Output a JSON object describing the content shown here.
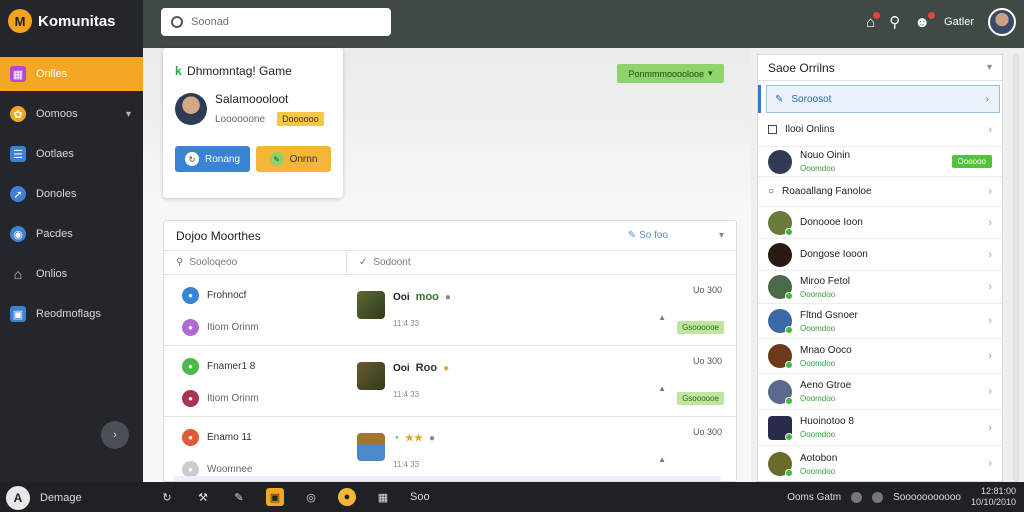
{
  "brand": {
    "name": "Komunitas",
    "logo_icon": "M"
  },
  "search": {
    "placeholder": "Soonad"
  },
  "topbar": {
    "user_label": "Gatler"
  },
  "sidebar": {
    "items": [
      {
        "label": "Onlles",
        "icon": "grid-icon",
        "color": "#b04ad8",
        "active": true
      },
      {
        "label": "Oomoos",
        "icon": "community-icon",
        "color": "#f5a623",
        "has_caret": true
      },
      {
        "label": "Ootlaes",
        "icon": "list-icon",
        "color": "#3a82d6"
      },
      {
        "label": "Donoles",
        "icon": "pin-icon",
        "color": "#3a82d6"
      },
      {
        "label": "Pacdes",
        "icon": "target-icon",
        "color": "#3a82d6"
      },
      {
        "label": "Onlios",
        "icon": "home-icon",
        "color": "#cfcfcf"
      },
      {
        "label": "Reodmoflags",
        "icon": "window-icon",
        "color": "#3a82d6"
      }
    ],
    "toggle_icon": "›"
  },
  "profile_card": {
    "title_prefix": "k",
    "title": "Dhmomntag! Game",
    "user_name": "Salamoooloot",
    "user_sub": "Loooooone",
    "user_badge": "Doooooo",
    "button_primary": "Ronang",
    "button_secondary": "Onrnn"
  },
  "filter_button": {
    "label": "Ponmmmoooolooe"
  },
  "panel": {
    "title": "Dojoo Moorthes",
    "link": "So foo",
    "col_left": "Sooloqeoo",
    "col_right": "Sodoont",
    "rows": [
      {
        "left_title": "Frohnocf",
        "left_sub": "Itiom Orinm",
        "left_icon_color_1": "#3a82d6",
        "left_icon_color_2": "#b06bd0",
        "right_title": "Ooi",
        "right_name": "moo",
        "right_time": "11:4 33",
        "meta": "Uo 300",
        "badge": "Gsoooooe"
      },
      {
        "left_title": "Fnamer1 8",
        "left_sub": "Itiom Orinm",
        "left_icon_color_1": "#4cb848",
        "left_icon_color_2": "#a63650",
        "right_title": "Ooi",
        "right_name": "Roo",
        "right_time": "11:4 33",
        "meta": "Uo 300",
        "badge": "Gsoooooe"
      },
      {
        "left_title": "Enamo 11",
        "left_sub": "Woomnee",
        "left_icon_color_1": "#e05a3a",
        "left_icon_color_2": "#cccccc",
        "right_title": "",
        "right_name": "",
        "right_time": "11:4 33",
        "meta": "Uo 300",
        "badge": ""
      }
    ]
  },
  "right_panel": {
    "title": "Saoe Orrilns",
    "selected": "Soroosot",
    "section_1": "Ilooi Onlins",
    "featured": {
      "name": "Nouo Oinin",
      "sub": "Ooomdoo",
      "badge": "Oooooo"
    },
    "section_2": "Roaoallang Fanoloe",
    "people": [
      {
        "name": "Donoooe Ioon",
        "sub": "",
        "color": "#6a7a3a",
        "online": true
      },
      {
        "name": "Dongose Iooon",
        "sub": "",
        "color": "#2b1a14",
        "online": false
      },
      {
        "name": "Miroo Fetol",
        "sub": "Ooomdoo",
        "color": "#4a6a4a",
        "online": true
      },
      {
        "name": "Fltnd Gsnoer",
        "sub": "Ooomdoo",
        "color": "#3a6aa6",
        "online": true
      },
      {
        "name": "Mnao Ooco",
        "sub": "Ooomdoo",
        "color": "#6a3a1a",
        "online": true
      },
      {
        "name": "Aeno Gtroe",
        "sub": "Ooomdoo",
        "color": "#5a6a8a",
        "online": true
      },
      {
        "name": "Huoinotoo 8",
        "sub": "Ooomdoo",
        "color": "#2a2a4a",
        "online": true
      },
      {
        "name": "Aotobon",
        "sub": "Ooomdoo",
        "color": "#6a6a2a",
        "online": true
      }
    ]
  },
  "taskbar": {
    "start_label": "Demage",
    "apps_label": "Soo",
    "tray_label": "Ooms Gatm",
    "tray_label_2": "Sooooooooooo",
    "time": "12:81:00",
    "date": "10/10/2010"
  }
}
